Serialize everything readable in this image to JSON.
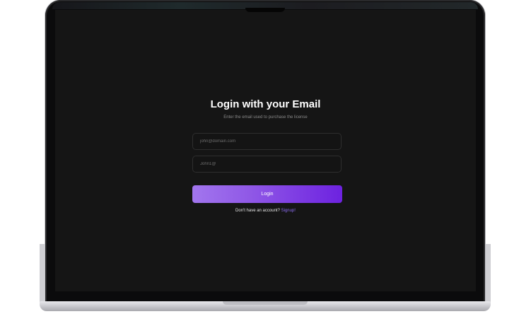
{
  "login": {
    "title": "Login with your Email",
    "subtitle": "Enter the email used to purchase the license",
    "email_placeholder": "john@domain.com",
    "password_placeholder": "John1@",
    "login_label": "Login",
    "signup_prompt": "Don't have an account?",
    "signup_link": "Signup!"
  },
  "colors": {
    "screen_background": "#151515",
    "button_gradient_start": "#a276ee",
    "button_gradient_end": "#6d22e0",
    "link": "#8b6cf0"
  }
}
